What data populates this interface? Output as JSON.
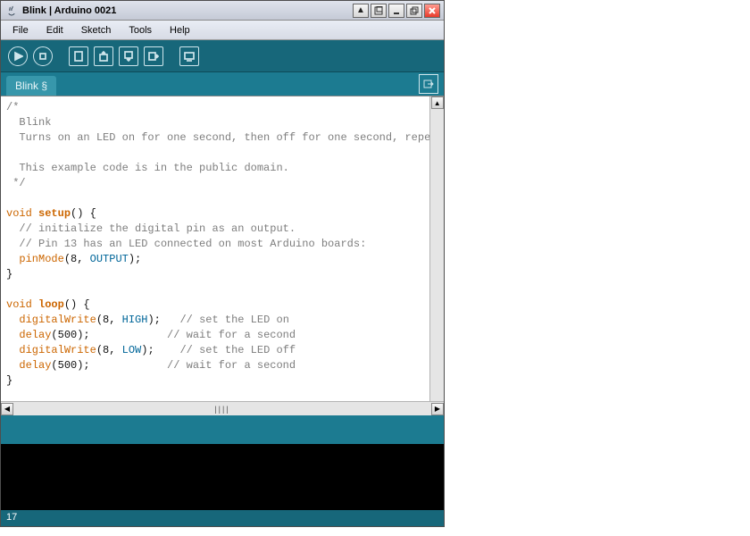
{
  "window": {
    "title": "Blink | Arduino 0021"
  },
  "menu": {
    "file": "File",
    "edit": "Edit",
    "sketch": "Sketch",
    "tools": "Tools",
    "help": "Help"
  },
  "tab": {
    "label": "Blink §"
  },
  "code": {
    "l1": "/*",
    "l2": "  Blink",
    "l3": "  Turns on an LED on for one second, then off for one second, repea",
    "l4": "  ",
    "l5": "  This example code is in the public domain.",
    "l6": " */",
    "l7": "",
    "l8a": "void ",
    "l8b": "setup",
    "l8c": "() {",
    "l9": "  // initialize the digital pin as an output.",
    "l10": "  // Pin 13 has an LED connected on most Arduino boards:",
    "l11a": "  ",
    "l11b": "pinMode",
    "l11c": "(8, ",
    "l11d": "OUTPUT",
    "l11e": ");",
    "l12": "}",
    "l13": "",
    "l14a": "void ",
    "l14b": "loop",
    "l14c": "() {",
    "l15a": "  ",
    "l15b": "digitalWrite",
    "l15c": "(8, ",
    "l15d": "HIGH",
    "l15e": ");   ",
    "l15f": "// set the LED on",
    "l16a": "  ",
    "l16b": "delay",
    "l16c": "(500);            ",
    "l16d": "// wait for a second",
    "l17a": "  ",
    "l17b": "digitalWrite",
    "l17c": "(8, ",
    "l17d": "LOW",
    "l17e": ");    ",
    "l17f": "// set the LED off",
    "l18a": "  ",
    "l18b": "delay",
    "l18c": "(500);            ",
    "l18d": "// wait for a second",
    "l19": "}"
  },
  "status": {
    "line": "17"
  },
  "icons": {
    "verify": "verify-icon",
    "stop": "stop-icon",
    "new": "new-icon",
    "open": "open-icon",
    "save": "save-icon",
    "upload": "upload-icon",
    "serial": "serial-icon"
  },
  "colors": {
    "accent": "#17677a",
    "tab": "#1c7b91",
    "keyword": "#cc6600",
    "const": "#006699"
  }
}
